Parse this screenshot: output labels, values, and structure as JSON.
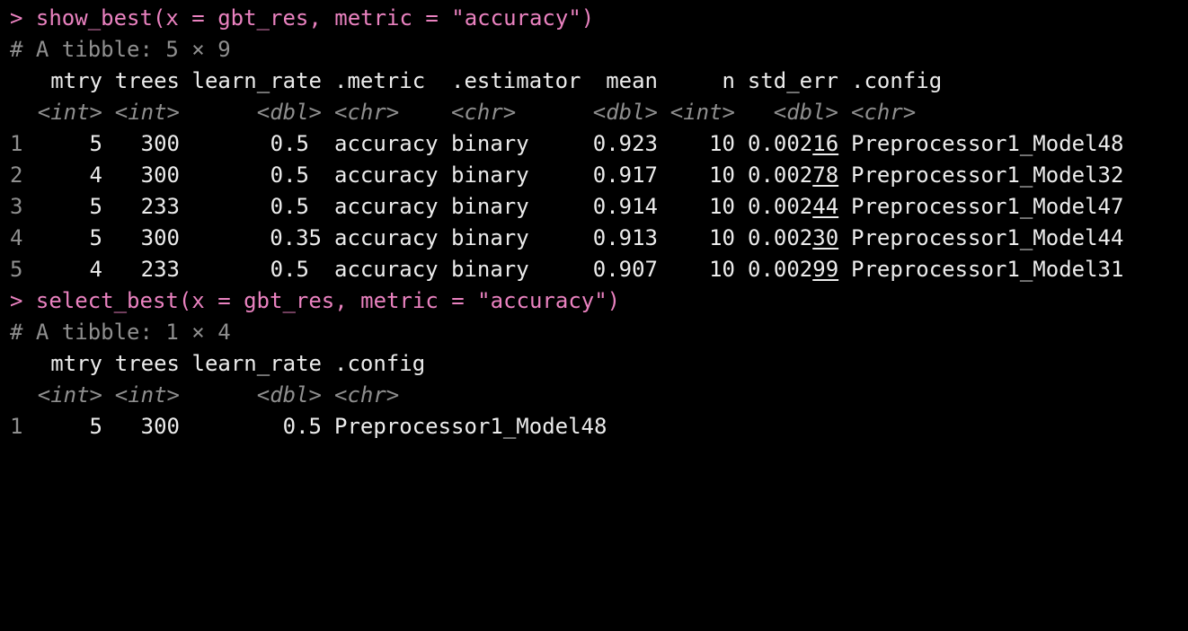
{
  "console": {
    "prompt_symbol": ">",
    "commands": [
      "show_best(x = gbt_res, metric = \"accuracy\")",
      "select_best(x = gbt_res, metric = \"accuracy\")"
    ],
    "tibble1": {
      "header": "# A tibble: 5 × 9",
      "columns": [
        "mtry",
        "trees",
        "learn_rate",
        ".metric",
        ".estimator",
        "mean",
        "n",
        "std_err",
        ".config"
      ],
      "types": [
        "<int>",
        "<int>",
        "<dbl>",
        "<chr>",
        "<chr>",
        "<dbl>",
        "<int>",
        "<dbl>",
        "<chr>"
      ],
      "rows": [
        {
          "idx": "1",
          "mtry": "5",
          "trees": "300",
          "learn_rate": "0.5",
          "metric": "accuracy",
          "estimator": "binary",
          "mean": "0.923",
          "n": "10",
          "std_err_lead": "0.002",
          "std_err_tail": "16",
          "config": "Preprocessor1_Model48"
        },
        {
          "idx": "2",
          "mtry": "4",
          "trees": "300",
          "learn_rate": "0.5",
          "metric": "accuracy",
          "estimator": "binary",
          "mean": "0.917",
          "n": "10",
          "std_err_lead": "0.002",
          "std_err_tail": "78",
          "config": "Preprocessor1_Model32"
        },
        {
          "idx": "3",
          "mtry": "5",
          "trees": "233",
          "learn_rate": "0.5",
          "metric": "accuracy",
          "estimator": "binary",
          "mean": "0.914",
          "n": "10",
          "std_err_lead": "0.002",
          "std_err_tail": "44",
          "config": "Preprocessor1_Model47"
        },
        {
          "idx": "4",
          "mtry": "5",
          "trees": "300",
          "learn_rate": "0.35",
          "metric": "accuracy",
          "estimator": "binary",
          "mean": "0.913",
          "n": "10",
          "std_err_lead": "0.002",
          "std_err_tail": "30",
          "config": "Preprocessor1_Model44"
        },
        {
          "idx": "5",
          "mtry": "4",
          "trees": "233",
          "learn_rate": "0.5",
          "metric": "accuracy",
          "estimator": "binary",
          "mean": "0.907",
          "n": "10",
          "std_err_lead": "0.002",
          "std_err_tail": "99",
          "config": "Preprocessor1_Model31"
        }
      ]
    },
    "tibble2": {
      "header": "# A tibble: 1 × 4",
      "columns": [
        "mtry",
        "trees",
        "learn_rate",
        ".config"
      ],
      "types": [
        "<int>",
        "<int>",
        "<dbl>",
        "<chr>"
      ],
      "rows": [
        {
          "idx": "1",
          "mtry": "5",
          "trees": "300",
          "learn_rate": "0.5",
          "config": "Preprocessor1_Model48"
        }
      ]
    }
  },
  "colors": {
    "background": "#000000",
    "text": "#ececec",
    "command": "#ea82c0",
    "muted": "#8f8f8f"
  }
}
